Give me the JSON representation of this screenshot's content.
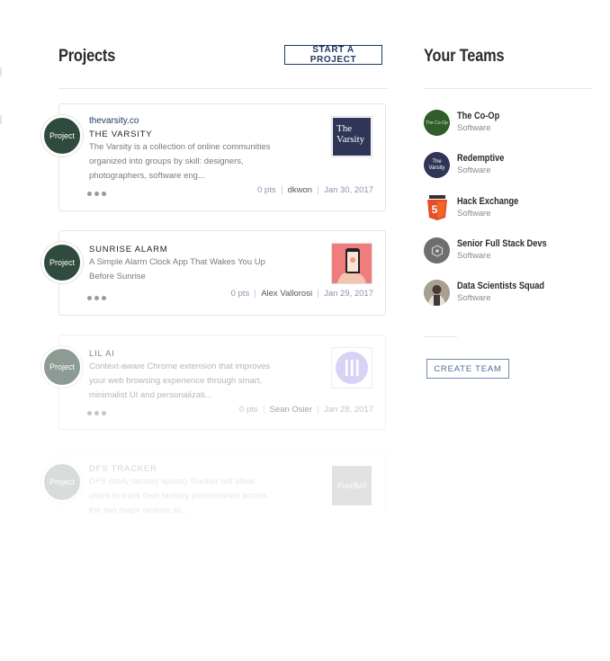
{
  "projects": {
    "title": "Projects",
    "start_label": "START A PROJECT",
    "avatar_label": "Project",
    "items": [
      {
        "link": "thevarsity.co",
        "title": "THE VARSITY",
        "description": "The Varsity is a collection of online communities organized into groups by skill: designers, photographers, software eng...",
        "points": "0 pts",
        "author": "dkwon",
        "date": "Jan 30, 2017",
        "thumb_text": "The Varsity"
      },
      {
        "title": "SUNRISE ALARM",
        "description": "A Simple Alarm Clock App That Wakes You Up Before Sunrise",
        "points": "0 pts",
        "author": "Alex Vallorosi",
        "date": "Jan 29, 2017"
      },
      {
        "title": "LIL AI",
        "description": "Context-aware Chrome extension that improves your web browsing experience through smart, minimalist UI and personalizati...",
        "points": "0 pts",
        "author": "Sean Osier",
        "date": "Jan 28, 2017"
      },
      {
        "title": "DFS TRACKER",
        "description": "DFS (daily fantasy sports) Tracker will allow users to track their fantasy performance across the two major fantasy sit...",
        "thumb_text": "FootBall"
      }
    ]
  },
  "teams": {
    "title": "Your Teams",
    "create_label": "CREATE TEAM",
    "items": [
      {
        "name": "The Co-Op",
        "type": "Software",
        "icon_text": "The Co-Op"
      },
      {
        "name": "Redemptive",
        "type": "Software",
        "icon_text": "The Varsity"
      },
      {
        "name": "Hack Exchange",
        "type": "Software",
        "icon_text": "5"
      },
      {
        "name": "Senior Full Stack Devs",
        "type": "Software"
      },
      {
        "name": "Data Scientists Squad",
        "type": "Software"
      }
    ]
  },
  "colors": {
    "navy": "#1f3a60",
    "project_avatar": "#2f4b3d",
    "html5_orange": "#e44d26"
  },
  "icons": [
    "hexagon-node-icon",
    "html5-icon",
    "person-photo-icon",
    "phone-photo-icon",
    "bars-logo-icon"
  ]
}
